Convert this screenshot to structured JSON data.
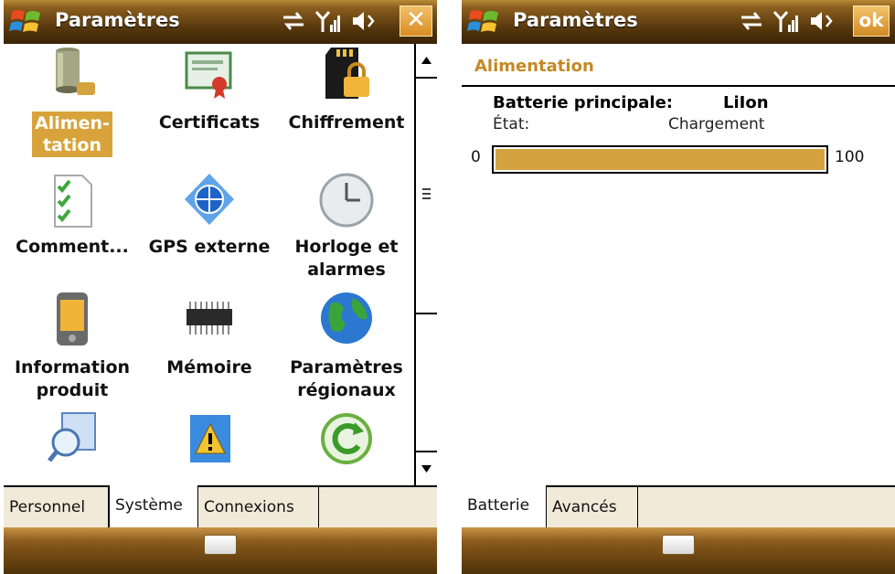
{
  "left_screen": {
    "title": "Paramètres",
    "close_label": "✕",
    "grid_items": [
      {
        "label": "Alimen-\ntation",
        "icon": "battery-icon",
        "selected": true
      },
      {
        "label": "Certificats",
        "icon": "certificate-icon"
      },
      {
        "label": "Chiffrement",
        "icon": "encryption-sdcard-lock-icon"
      },
      {
        "label": "Comment...",
        "icon": "checklist-icon"
      },
      {
        "label": "GPS externe",
        "icon": "gps-globe-icon"
      },
      {
        "label": "Horloge et\nalarmes",
        "icon": "clock-icon"
      },
      {
        "label": "Information\nproduit",
        "icon": "pda-device-icon"
      },
      {
        "label": "Mémoire",
        "icon": "memory-chip-icon"
      },
      {
        "label": "Paramètres\nrégionaux",
        "icon": "earth-globe-icon"
      },
      {
        "label": "",
        "icon": "search-windows-icon"
      },
      {
        "label": "",
        "icon": "warning-report-icon"
      },
      {
        "label": "",
        "icon": "reset-arrow-icon"
      }
    ],
    "tabs": [
      "Personnel",
      "Système",
      "Connexions"
    ],
    "active_tab": "Système"
  },
  "right_screen": {
    "title": "Paramètres",
    "ok_label": "ok",
    "heading": "Alimentation",
    "battery_label": "Batterie principale:",
    "battery_type": "LiIon",
    "state_label": "État:",
    "state_value": "Chargement",
    "progress_min": "0",
    "progress_max": "100",
    "progress_fraction": 1.0,
    "tabs": [
      "Batterie",
      "Avancés"
    ],
    "active_tab": "Batterie"
  },
  "colors": {
    "accent": "#d9a33b",
    "title_bar": "#5a3a0e",
    "heading": "#c48924"
  }
}
